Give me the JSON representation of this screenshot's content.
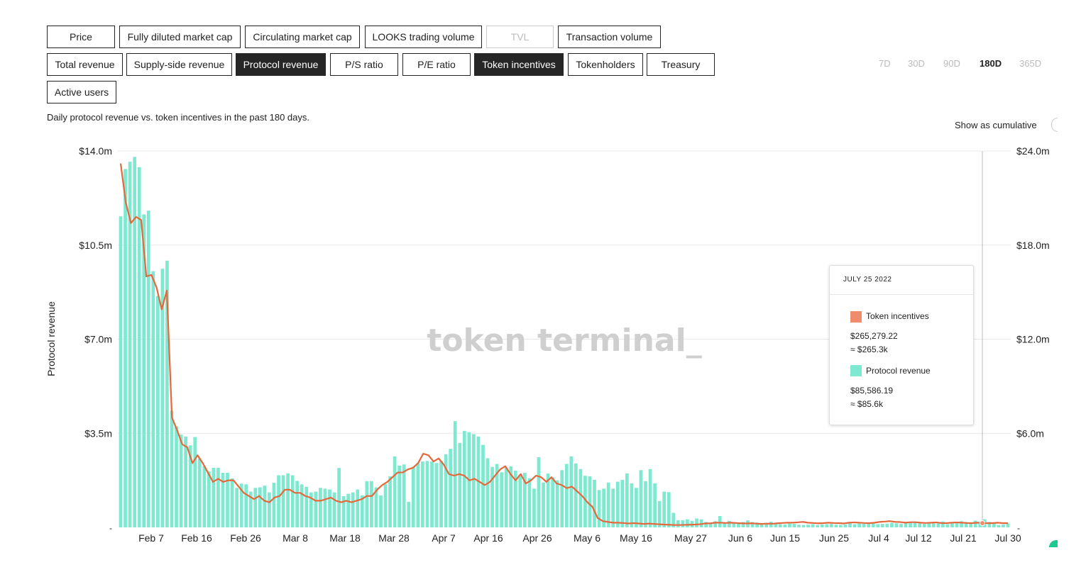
{
  "metrics_row1": [
    "Price",
    "Fully diluted market cap",
    "Circulating market cap",
    "LOOKS trading volume",
    "TVL",
    "Transaction volume"
  ],
  "metrics_row2": [
    "Total revenue",
    "Supply-side revenue",
    "Protocol revenue",
    "P/S ratio",
    "P/E ratio",
    "Token incentives",
    "Tokenholders",
    "Treasury"
  ],
  "metrics_row3": [
    "Active users"
  ],
  "time_ranges": [
    "7D",
    "30D",
    "90D",
    "180D",
    "365D"
  ],
  "selected_range": "180D",
  "subtitle": "Daily protocol revenue vs. token incentives in the past 180 days.",
  "cumulative_label": "Show as cumulative",
  "watermark": "token terminal_",
  "colors": {
    "bar": "#7ee9d0",
    "line": "#e5683d",
    "swatch_line": "#f08c6e",
    "active_btn": "#262626"
  },
  "tooltip": {
    "date": "JULY 25 2022",
    "series1_name": "Token incentives",
    "series1_value": "$265,279.22",
    "series1_approx": "≈ $265.3k",
    "series2_name": "Protocol revenue",
    "series2_value": "$85,586.19",
    "series2_approx": "≈ $85.6k"
  },
  "chart_data": {
    "type": "bar",
    "title": "",
    "ylabel": "Protocol revenue",
    "xlabel": "",
    "left_axis": {
      "ticks": [
        "-",
        "$3.5m",
        "$7.0m",
        "$10.5m",
        "$14.0m"
      ],
      "ylim": [
        0,
        14.0
      ],
      "unit": "$m"
    },
    "right_axis": {
      "ticks": [
        "-",
        "$6.0m",
        "$12.0m",
        "$18.0m",
        "$24.0m"
      ],
      "ylim": [
        0,
        24.0
      ],
      "unit": "$m"
    },
    "x_tick_labels": [
      "Feb 7",
      "Feb 16",
      "Feb 26",
      "Mar 8",
      "Mar 18",
      "Mar 28",
      "Apr 7",
      "Apr 16",
      "Apr 26",
      "May 6",
      "May 16",
      "May 27",
      "Jun 6",
      "Jun 15",
      "Jun 25",
      "Jul 4",
      "Jul 12",
      "Jul 21",
      "Jul 30"
    ],
    "grid": "horizontal",
    "series": [
      {
        "name": "Protocol revenue",
        "kind": "bar",
        "axis": "left",
        "values": [
          11.57,
          13.33,
          13.6,
          13.78,
          13.4,
          11.64,
          11.78,
          9.53,
          8.61,
          9.62,
          9.92,
          4.34,
          3.76,
          3.45,
          3.38,
          3.05,
          3.36,
          2.57,
          2.27,
          2.08,
          2.22,
          2.22,
          2.03,
          2.03,
          1.82,
          1.47,
          1.63,
          1.6,
          1.33,
          1.47,
          1.49,
          1.55,
          1.3,
          1.66,
          1.94,
          1.94,
          2.01,
          1.94,
          1.73,
          1.6,
          1.51,
          1.3,
          1.33,
          1.47,
          1.44,
          1.41,
          1.3,
          2.21,
          1.16,
          1.25,
          1.3,
          1.41,
          1.19,
          1.72,
          1.72,
          1.49,
          1.19,
          1.61,
          1.9,
          2.64,
          2.3,
          2.34,
          0.95,
          2.25,
          2.39,
          2.45,
          2.47,
          2.45,
          2.39,
          2.47,
          2.72,
          2.92,
          3.95,
          3.14,
          3.59,
          3.54,
          3.47,
          3.38,
          3.07,
          2.57,
          2.25,
          2.36,
          2.05,
          2.22,
          2.27,
          2.11,
          1.95,
          2.03,
          1.83,
          1.44,
          2.61,
          1.67,
          2.0,
          1.86,
          1.75,
          2.13,
          2.36,
          2.64,
          2.38,
          2.17,
          1.92,
          1.9,
          1.77,
          1.39,
          1.44,
          1.67,
          1.44,
          1.7,
          1.77,
          2.01,
          1.64,
          1.47,
          2.13,
          1.72,
          2.17,
          1.64,
          0.98,
          1.33,
          1.31,
          0.54,
          0.27,
          0.27,
          0.3,
          0.24,
          0.33,
          0.3,
          0.2,
          0.17,
          0.23,
          0.42,
          0.19,
          0.24,
          0.19,
          0.17,
          0.2,
          0.26,
          0.2,
          0.18,
          0.15,
          0.17,
          0.21,
          0.13,
          0.12,
          0.11,
          0.14,
          0.13,
          0.1,
          0.09,
          0.1,
          0.12,
          0.09,
          0.11,
          0.12,
          0.13,
          0.1,
          0.09,
          0.11,
          0.2,
          0.12,
          0.14,
          0.13,
          0.15,
          0.16,
          0.12,
          0.13,
          0.14,
          0.17,
          0.15,
          0.13,
          0.18,
          0.2,
          0.17,
          0.15,
          0.13,
          0.16,
          0.17,
          0.15,
          0.22,
          0.12,
          0.19,
          0.17,
          0.23,
          0.2,
          0.15,
          0.25,
          0.22,
          0.3,
          0.2,
          0.17,
          0.09,
          0.11,
          0.15
        ]
      },
      {
        "name": "Token incentives",
        "kind": "line",
        "axis": "right",
        "values": [
          23.2,
          20.7,
          19.4,
          19.8,
          19.6,
          16.0,
          16.1,
          15.3,
          13.9,
          15.1,
          7.0,
          6.2,
          5.3,
          5.1,
          4.1,
          4.6,
          4.1,
          3.5,
          2.9,
          3.1,
          2.9,
          3.0,
          3.0,
          2.6,
          2.2,
          2.0,
          1.8,
          2.0,
          1.7,
          1.6,
          1.9,
          2.0,
          2.4,
          2.4,
          2.2,
          2.2,
          2.0,
          1.9,
          1.7,
          1.7,
          1.8,
          1.9,
          1.7,
          1.6,
          1.7,
          1.6,
          1.7,
          1.8,
          2.0,
          2.0,
          2.4,
          2.7,
          2.9,
          3.2,
          3.5,
          3.5,
          3.7,
          3.8,
          4.1,
          4.7,
          4.6,
          4.2,
          4.4,
          4.0,
          3.4,
          3.3,
          3.4,
          3.3,
          3.0,
          3.1,
          2.9,
          2.7,
          2.9,
          3.3,
          3.7,
          3.9,
          3.4,
          3.0,
          3.4,
          2.8,
          3.0,
          3.3,
          3.2,
          2.9,
          3.2,
          2.8,
          2.7,
          2.5,
          2.6,
          2.3,
          2.0,
          1.6,
          1.3,
          0.6,
          0.4,
          0.35,
          0.3,
          0.3,
          0.28,
          0.25,
          0.27,
          0.25,
          0.22,
          0.24,
          0.22,
          0.2,
          0.18,
          0.17,
          0.15,
          0.15,
          0.16,
          0.17,
          0.18,
          0.2,
          0.25,
          0.26,
          0.3,
          0.3,
          0.28,
          0.3,
          0.28,
          0.26,
          0.25,
          0.26,
          0.24,
          0.22,
          0.24,
          0.23,
          0.26,
          0.28,
          0.3,
          0.3,
          0.32,
          0.35,
          0.3,
          0.28,
          0.26,
          0.27,
          0.3,
          0.28,
          0.27,
          0.25,
          0.3,
          0.32,
          0.3,
          0.28,
          0.27,
          0.3,
          0.35,
          0.37,
          0.4,
          0.35,
          0.34,
          0.3,
          0.33,
          0.33,
          0.3,
          0.28,
          0.3,
          0.32,
          0.28,
          0.27,
          0.3,
          0.32,
          0.3,
          0.28,
          0.27,
          0.3,
          0.28,
          0.27,
          0.27,
          0.3,
          0.27,
          0.27
        ]
      }
    ]
  }
}
